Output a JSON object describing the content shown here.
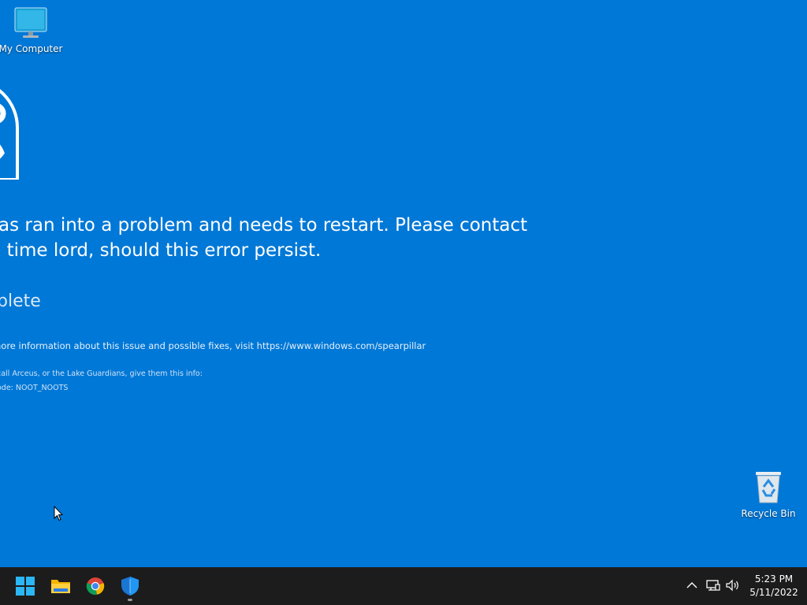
{
  "desktop": {
    "background_color": "#0078d7",
    "icons": {
      "my_computer": {
        "label": "My Computer",
        "icon": "monitor-icon"
      },
      "recycle_bin": {
        "label": "Recycle Bin",
        "icon": "recycle-bin-icon"
      }
    }
  },
  "bsod": {
    "face_icon": "sad-face-icon",
    "line1": "as ran into a problem and needs to restart. Please contact",
    "line2": ". time lord, should this error persist.",
    "progress_text": "plete",
    "info_text": "nore information about this issue and possible fixes, visit https://www.windows.com/spearpillar",
    "contact_text": "call Arceus, or the Lake Guardians, give them this info:",
    "stop_code_text": "ode: NOOT_NOOTS"
  },
  "taskbar": {
    "background_color": "#1c1c1c",
    "apps": [
      {
        "name": "Start",
        "icon": "windows-start-icon"
      },
      {
        "name": "File Explorer",
        "icon": "folder-icon"
      },
      {
        "name": "Google Chrome",
        "icon": "chrome-icon"
      },
      {
        "name": "Windows Security",
        "icon": "shield-icon"
      }
    ],
    "tray": {
      "icons": [
        "chevron-up-icon",
        "network-icon",
        "volume-icon"
      ],
      "time": "5:23 PM",
      "date": "5/11/2022"
    }
  }
}
